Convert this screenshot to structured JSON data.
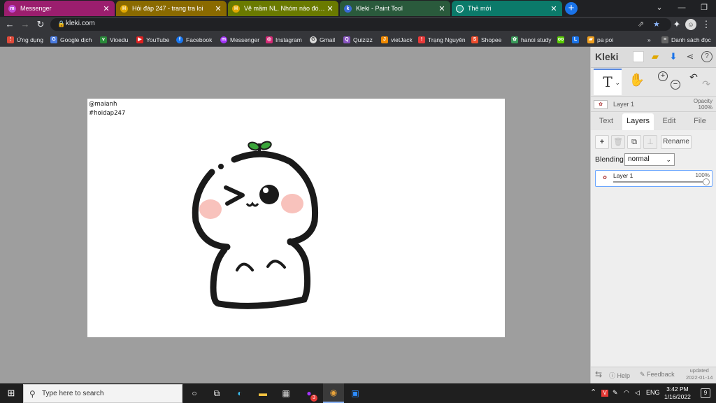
{
  "browser": {
    "tabs": [
      {
        "title": "Messenger",
        "color": "#9b1e6e",
        "icon": "messenger-icon"
      },
      {
        "title": "Hỏi đáp 247 - trang tra loi",
        "color": "#8a6a00",
        "icon": "hoidap-icon"
      },
      {
        "title": "Vẽ mầm NL. Nhóm nào đó.. biết...",
        "color": "#6a7a00",
        "icon": "hoidap-icon"
      },
      {
        "title": "Kleki - Paint Tool",
        "color": "#2a5a3c",
        "icon": "kleki-icon"
      },
      {
        "title": "Thẻ mới",
        "color": "#0b7a6a",
        "icon": "chrome-icon"
      }
    ],
    "url": "kleki.com",
    "bookmarks": [
      {
        "label": "Ứng dụng",
        "color": "#e04a3a",
        "icon": "apps-icon"
      },
      {
        "label": "Google dịch",
        "color": "#4a7be0",
        "icon": "google-translate-icon"
      },
      {
        "label": "Vioedu",
        "color": "#2a8a3a",
        "icon": "vioedu-icon"
      },
      {
        "label": "YouTube",
        "color": "#e02020",
        "icon": "youtube-icon"
      },
      {
        "label": "Facebook",
        "color": "#1877f2",
        "icon": "facebook-icon"
      },
      {
        "label": "Messenger",
        "color": "#a334fa",
        "icon": "messenger-icon"
      },
      {
        "label": "Instagram",
        "color": "#d62976",
        "icon": "instagram-icon"
      },
      {
        "label": "Gmail",
        "color": "#dddddd",
        "icon": "google-icon"
      },
      {
        "label": "Quizizz",
        "color": "#8854c0",
        "icon": "quizizz-icon"
      },
      {
        "label": "vietJack",
        "color": "#f08a00",
        "icon": "vietjack-icon"
      },
      {
        "label": "Trạng Nguyên",
        "color": "#e83a3a",
        "icon": "trang-nguyen-icon"
      },
      {
        "label": "Shopee",
        "color": "#ee4d2d",
        "icon": "shopee-icon"
      },
      {
        "label": "hanoi study",
        "color": "#3a9a5a",
        "icon": "hanoi-study-icon"
      },
      {
        "label": "",
        "color": "#58cc02",
        "icon": "duolingo-icon"
      },
      {
        "label": "",
        "color": "#1a73e8",
        "icon": "l-icon"
      },
      {
        "label": "pa poi",
        "color": "#f0a020",
        "icon": "pa-poi-icon"
      }
    ],
    "bookmarks_overflow": "»",
    "reading_list": "Danh sách đọc"
  },
  "canvas": {
    "caption_1": "@maianh",
    "caption_2": "#hoidap247"
  },
  "kleki": {
    "logo": "Kleki",
    "current_layer": "Layer 1",
    "opacity_label": "Opacity",
    "opacity_value": "100%",
    "tabs": [
      "Text",
      "Layers",
      "Edit",
      "File"
    ],
    "active_tab": "Layers",
    "rename": "Rename",
    "blending_label": "Blending",
    "blending_value": "normal",
    "layer_name": "Layer 1",
    "layer_opacity": "100%",
    "layer_opacity_fraction": 1.0,
    "help": "Help",
    "feedback": "Feedback",
    "updated_label": "updated",
    "updated_date": "2022-01-14"
  },
  "taskbar": {
    "search_placeholder": "Type here to search",
    "lang": "ENG",
    "time": "3:42 PM",
    "date": "1/16/2022",
    "messenger_badge": "3",
    "notif_count": "9"
  }
}
